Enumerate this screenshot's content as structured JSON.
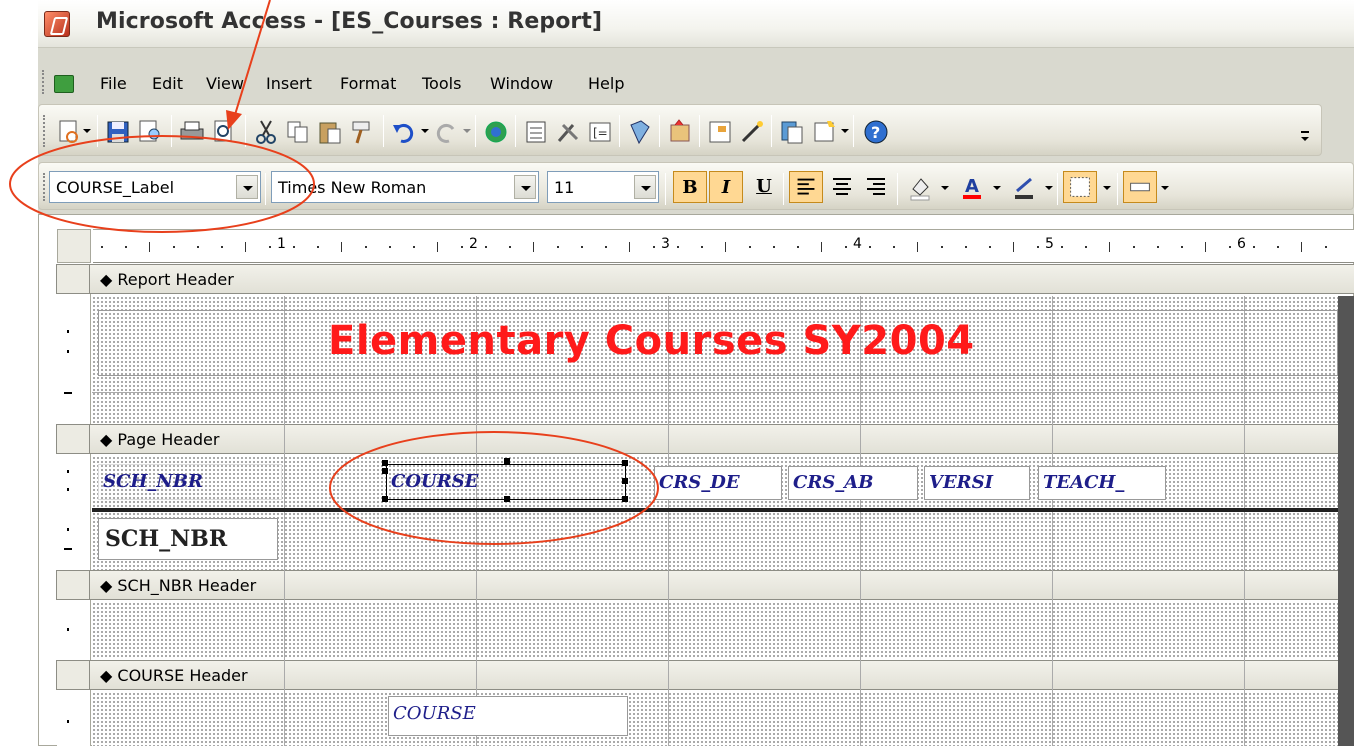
{
  "window": {
    "title": "Microsoft Access - [ES_Courses : Report]"
  },
  "menu": {
    "items": [
      {
        "label": "File"
      },
      {
        "label": "Edit"
      },
      {
        "label": "View"
      },
      {
        "label": "Insert"
      },
      {
        "label": "Format"
      },
      {
        "label": "Tools"
      },
      {
        "label": "Window"
      },
      {
        "label": "Help"
      }
    ]
  },
  "toolbar": {
    "icons": [
      "view-icon",
      "save-icon",
      "file-search-icon",
      "print-icon",
      "print-preview-icon",
      "cut-icon",
      "copy-icon",
      "paste-icon",
      "format-painter-icon",
      "undo-icon",
      "redo-icon",
      "field-list-icon",
      "toolbox-icon",
      "sorting-grouping-icon",
      "autoformat-icon",
      "code-icon",
      "properties-icon",
      "build-icon",
      "database-window-icon",
      "new-object-icon",
      "help-icon"
    ]
  },
  "formatting": {
    "object_selector": "COURSE_Label",
    "font_name": "Times New Roman",
    "font_size": "11",
    "bold_label": "B",
    "italic_label": "I",
    "underline_label": "U"
  },
  "ruler": {
    "numbers": [
      "1",
      "2",
      "3",
      "4",
      "5",
      "6"
    ]
  },
  "sections": {
    "report_header": "Report Header",
    "page_header": "Page Header",
    "sch_nbr_header": "SCH_NBR Header",
    "course_header": "COURSE Header"
  },
  "report_title": "Elementary Courses SY2004",
  "page_header_controls": [
    "SCH_NBR",
    "COURSE",
    "CRS_DE",
    "CRS_AB",
    "VERSI",
    "TEACH_"
  ],
  "sch_nbr_field": "SCH_NBR",
  "course_field": "COURSE",
  "colors": {
    "title_red": "#ff1a1a",
    "label_blue": "#1e1e8a",
    "annotation": "#e8401c"
  }
}
